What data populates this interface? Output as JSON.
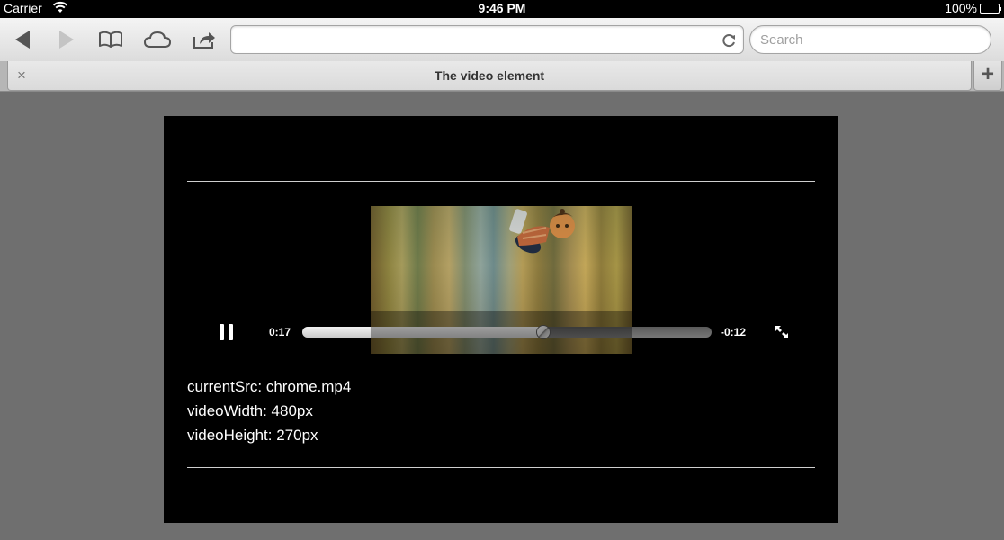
{
  "status_bar": {
    "carrier": "Carrier",
    "time": "9:46 PM",
    "battery": "100%"
  },
  "toolbar": {
    "url": "",
    "search_placeholder": "Search"
  },
  "tab": {
    "title": "The video element",
    "close_glyph": "×",
    "new_tab_glyph": "+"
  },
  "video": {
    "progress": 0.59,
    "elapsed": "0:17",
    "remaining": "-0:12"
  },
  "info": {
    "current_src": "currentSrc: chrome.mp4",
    "video_width": "videoWidth: 480px",
    "video_height": "videoHeight: 270px"
  }
}
